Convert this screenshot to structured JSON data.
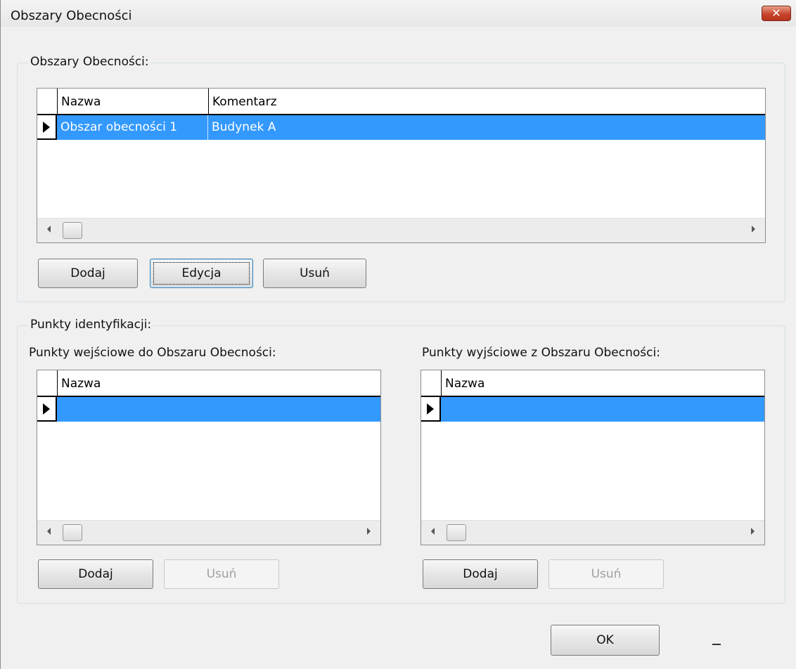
{
  "window": {
    "title": "Obszary Obecności",
    "close_symbol": "✕"
  },
  "areas_group": {
    "legend": "Obszary Obecności:",
    "columns": [
      "Nazwa",
      "Komentarz"
    ],
    "rows": [
      {
        "name": "Obszar obecności 1",
        "comment": "Budynek A"
      }
    ],
    "buttons": {
      "add": "Dodaj",
      "edit": "Edycja",
      "delete": "Usuń"
    }
  },
  "points_group": {
    "legend": "Punkty identyfikacji:",
    "entry": {
      "label": "Punkty wejściowe do Obszaru Obecności:",
      "column": "Nazwa",
      "add": "Dodaj",
      "delete": "Usuń"
    },
    "exit": {
      "label": "Punkty wyjściowe z Obszaru Obecności:",
      "column": "Nazwa",
      "add": "Dodaj",
      "delete": "Usuń"
    }
  },
  "ok_button": "OK",
  "colors": {
    "selection": "#3399ff",
    "close_button": "#c7452c"
  },
  "icons": [
    "close-icon",
    "row-pointer-icon",
    "scroll-left-icon",
    "scroll-right-icon"
  ]
}
